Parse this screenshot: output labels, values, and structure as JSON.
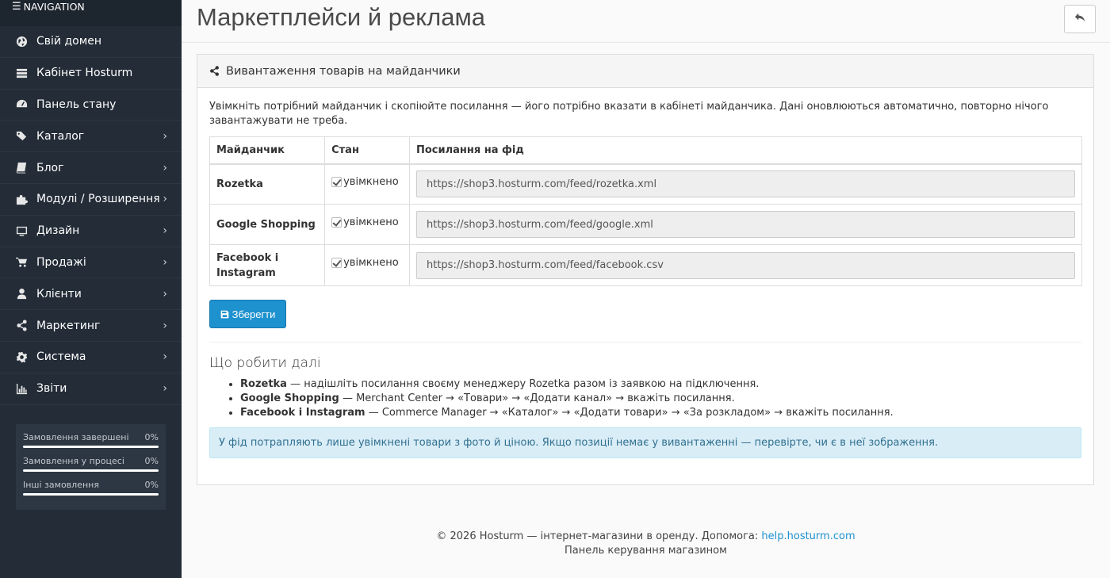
{
  "sidebar": {
    "header": "NAVIGATION",
    "items": [
      {
        "label": "Свій домен",
        "icon": "globe-icon",
        "has_children": false
      },
      {
        "label": "Кабінет Hosturm",
        "icon": "server-icon",
        "has_children": false
      },
      {
        "label": "Панель стану",
        "icon": "dashboard-icon",
        "has_children": false
      },
      {
        "label": "Каталог",
        "icon": "tags-icon",
        "has_children": true
      },
      {
        "label": "Блог",
        "icon": "book-icon",
        "has_children": true
      },
      {
        "label": "Модулі / Розширення",
        "icon": "puzzle-icon",
        "has_children": true
      },
      {
        "label": "Дизайн",
        "icon": "monitor-icon",
        "has_children": true
      },
      {
        "label": "Продажі",
        "icon": "cart-icon",
        "has_children": true
      },
      {
        "label": "Клієнти",
        "icon": "user-icon",
        "has_children": true
      },
      {
        "label": "Маркетинг",
        "icon": "share-icon",
        "has_children": true
      },
      {
        "label": "Система",
        "icon": "gear-icon",
        "has_children": true
      },
      {
        "label": "Звіти",
        "icon": "bar-chart-icon",
        "has_children": true
      }
    ],
    "stats": [
      {
        "label": "Замовлення завершені",
        "value": "0%",
        "progress": 0
      },
      {
        "label": "Замовлення у процесі",
        "value": "0%",
        "progress": 0
      },
      {
        "label": "Інші замовлення",
        "value": "0%",
        "progress": 0
      }
    ]
  },
  "header": {
    "title": "Маркетплейси й реклама"
  },
  "panel": {
    "title": "Вивантаження товарів на майданчики",
    "intro": "Увімкніть потрібний майданчик і скопіюйте посилання — його потрібно вказати в кабінеті майданчика. Дані оновлюються автоматично, повторно нічого завантажувати не треба.",
    "columns": [
      "Майданчик",
      "Стан",
      "Посилання на фід"
    ],
    "rows": [
      {
        "name": "Rozetka",
        "state": "увімкнено",
        "checked": true,
        "url": "https://shop3.hosturm.com/feed/rozetka.xml"
      },
      {
        "name": "Google Shopping",
        "state": "увімкнено",
        "checked": true,
        "url": "https://shop3.hosturm.com/feed/google.xml"
      },
      {
        "name": "Facebook і Instagram",
        "state": "увімкнено",
        "checked": true,
        "url": "https://shop3.hosturm.com/feed/facebook.csv"
      }
    ],
    "save_label": "Зберегти",
    "next_title": "Що робити далі",
    "next_steps": [
      {
        "name": "Rozetka",
        "text": " — надішліть посилання своєму менеджеру Rozetka разом із заявкою на підключення."
      },
      {
        "name": "Google Shopping",
        "text": " — Merchant Center → «Товари» → «Додати канал» → вкажіть посилання."
      },
      {
        "name": "Facebook і Instagram",
        "text": " — Commerce Manager → «Каталог» → «Додати товари» → «За розкладом» → вкажіть посилання."
      }
    ],
    "alert": "У фід потрапляють лише увімкнені товари з фото й ціною. Якщо позиції немає у вивантаженні — перевірте, чи є в неї зображення."
  },
  "footer": {
    "text": "© 2026 Hosturm — інтернет-магазини в оренду. Допомога: ",
    "link": "help.hosturm.com",
    "subtext": "Панель керування магазином"
  }
}
